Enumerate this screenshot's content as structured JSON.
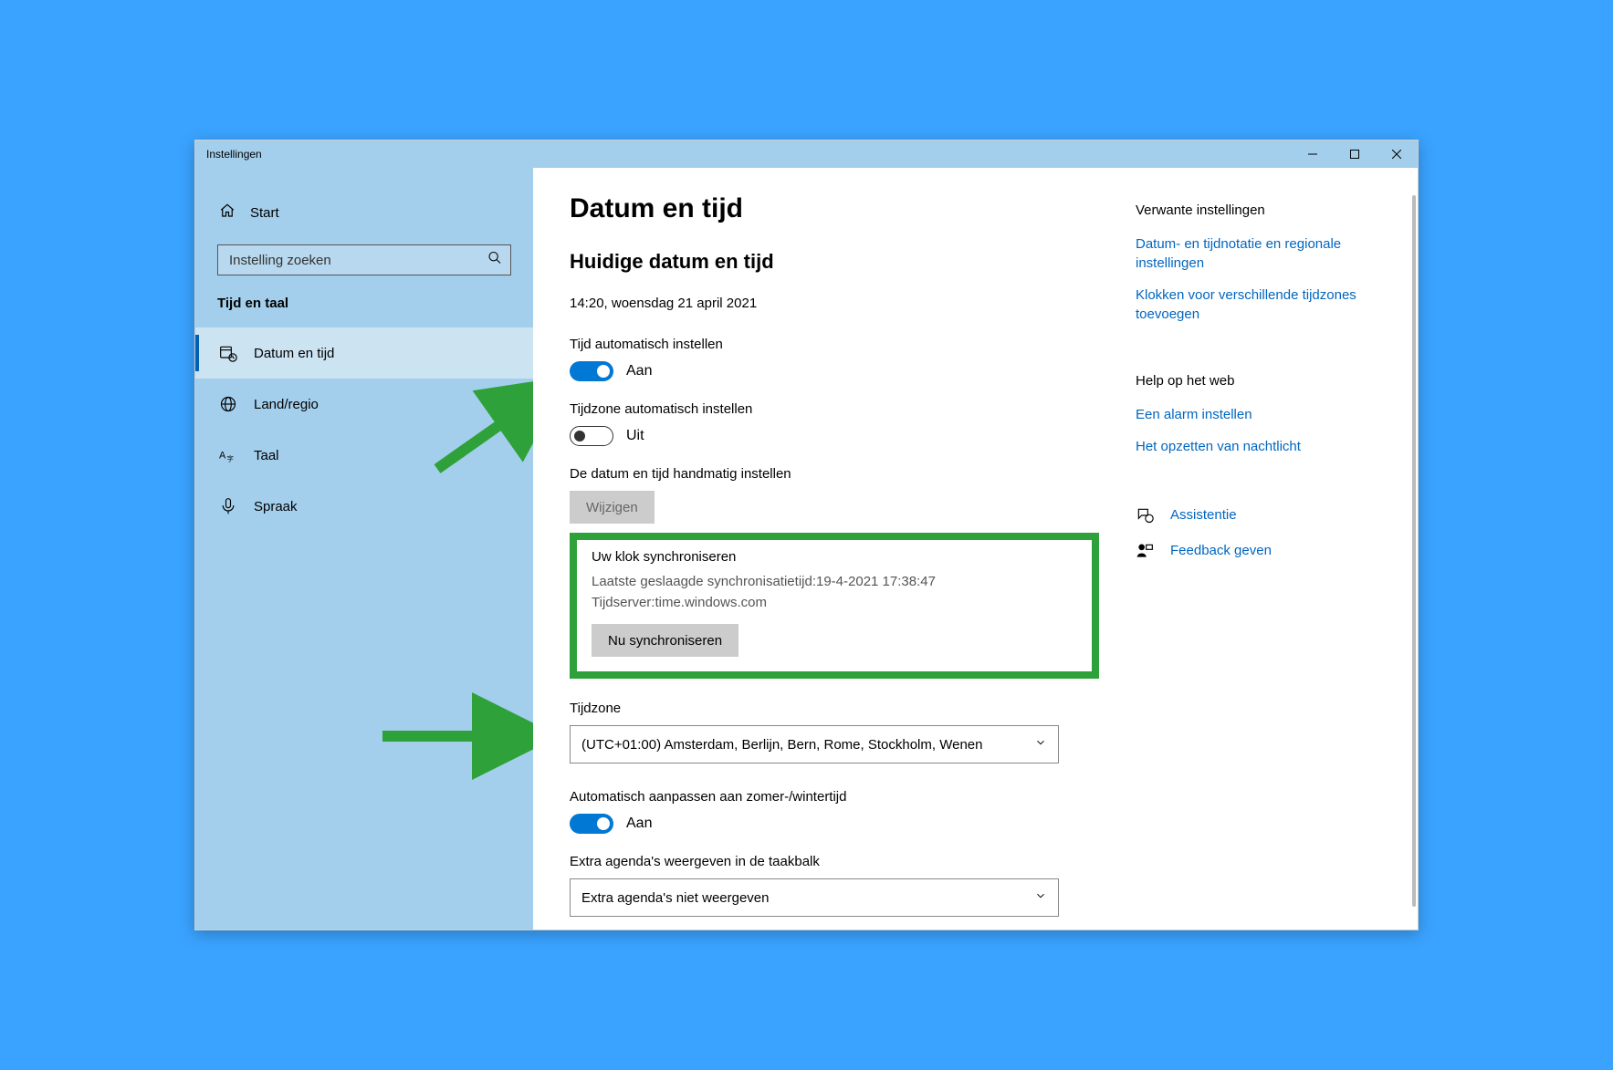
{
  "window": {
    "title": "Instellingen"
  },
  "sidebar": {
    "home": "Start",
    "search_placeholder": "Instelling zoeken",
    "category": "Tijd en taal",
    "items": [
      {
        "label": "Datum en tijd",
        "active": true
      },
      {
        "label": "Land/regio"
      },
      {
        "label": "Taal"
      },
      {
        "label": "Spraak"
      }
    ]
  },
  "page": {
    "title": "Datum en tijd",
    "current_heading": "Huidige datum en tijd",
    "current_value": "14:20, woensdag 21 april 2021",
    "auto_time_label": "Tijd automatisch instellen",
    "auto_time_state": "Aan",
    "auto_tz_label": "Tijdzone automatisch instellen",
    "auto_tz_state": "Uit",
    "manual_label": "De datum en tijd handmatig instellen",
    "change_button": "Wijzigen",
    "sync": {
      "heading": "Uw klok synchroniseren",
      "last": "Laatste geslaagde synchronisatietijd:19-4-2021 17:38:47",
      "server": "Tijdserver:time.windows.com",
      "button": "Nu synchroniseren"
    },
    "timezone_label": "Tijdzone",
    "timezone_value": "(UTC+01:00) Amsterdam, Berlijn, Bern, Rome, Stockholm, Wenen",
    "dst_label": "Automatisch aanpassen aan zomer-/wintertijd",
    "dst_state": "Aan",
    "extra_cal_label": "Extra agenda's weergeven in de taakbalk",
    "extra_cal_value": "Extra agenda's niet weergeven"
  },
  "right": {
    "related_heading": "Verwante instellingen",
    "related_links": [
      "Datum- en tijdnotatie en regionale instellingen",
      "Klokken voor verschillende tijdzones toevoegen"
    ],
    "help_heading": "Help op het web",
    "help_links": [
      "Een alarm instellen",
      "Het opzetten van nachtlicht"
    ],
    "assist": "Assistentie",
    "feedback": "Feedback geven"
  }
}
